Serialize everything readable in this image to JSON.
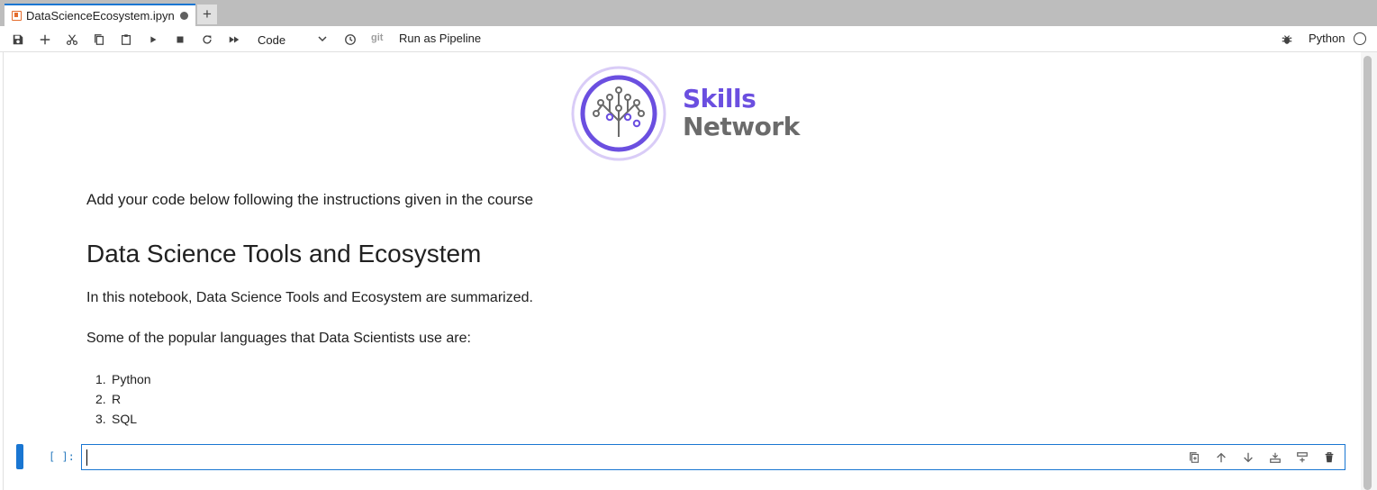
{
  "tab": {
    "title": "DataScienceEcosystem.ipyn",
    "new_tab_label": "+"
  },
  "toolbar": {
    "cell_type": "Code",
    "git_label": "git",
    "pipeline_label": "Run as Pipeline",
    "kernel_name": "Python"
  },
  "logo": {
    "line1": "Skills",
    "line2": "Network",
    "accent": "#6b4fe0"
  },
  "notebook": {
    "instruction": "Add your code below following the instructions given in the course",
    "heading": "Data Science Tools and Ecosystem",
    "intro": "In this notebook, Data Science Tools and Ecosystem are summarized.",
    "languages_intro": "Some of the popular languages that Data Scientists use are:",
    "languages": [
      {
        "num": "1.",
        "name": "Python"
      },
      {
        "num": "2.",
        "name": "R"
      },
      {
        "num": "3.",
        "name": "SQL"
      }
    ]
  },
  "code_cell": {
    "prompt": "[ ]:",
    "value": ""
  },
  "colors": {
    "active": "#1976d2",
    "prompt": "#307fc1"
  }
}
